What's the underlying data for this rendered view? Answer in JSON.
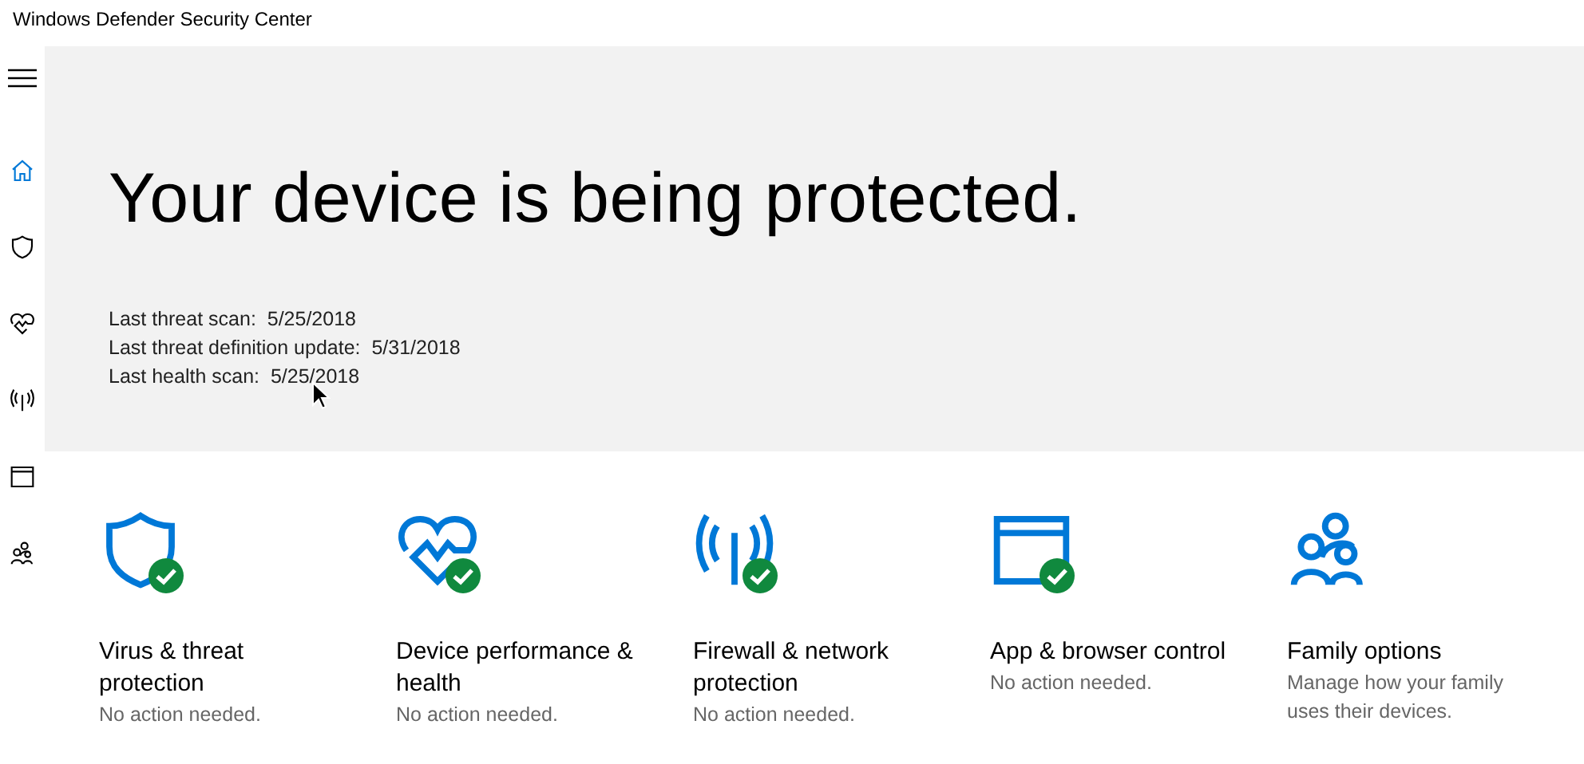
{
  "window": {
    "title": "Windows Defender Security Center"
  },
  "sidebar": {
    "items": [
      {
        "kind": "home",
        "selected": true
      },
      {
        "kind": "shield",
        "selected": false
      },
      {
        "kind": "heart",
        "selected": false
      },
      {
        "kind": "antenna",
        "selected": false
      },
      {
        "kind": "window",
        "selected": false
      },
      {
        "kind": "family",
        "selected": false
      }
    ]
  },
  "hero": {
    "headline": "Your device is being protected.",
    "details": [
      {
        "label": "Last threat scan:",
        "value": "5/25/2018"
      },
      {
        "label": "Last threat definition update:",
        "value": "5/31/2018"
      },
      {
        "label": "Last health scan:",
        "value": "5/25/2018"
      }
    ]
  },
  "tiles": [
    {
      "kind": "shield",
      "title": "Virus & threat protection",
      "status": "No action needed.",
      "ok": true
    },
    {
      "kind": "heart",
      "title": "Device performance & health",
      "status": "No action needed.",
      "ok": true
    },
    {
      "kind": "antenna",
      "title": "Firewall & network protection",
      "status": "No action needed.",
      "ok": true
    },
    {
      "kind": "window",
      "title": "App & browser control",
      "status": "No action needed.",
      "ok": true
    },
    {
      "kind": "family",
      "title": "Family options",
      "status": "Manage how your family uses their devices.",
      "ok": false
    }
  ]
}
